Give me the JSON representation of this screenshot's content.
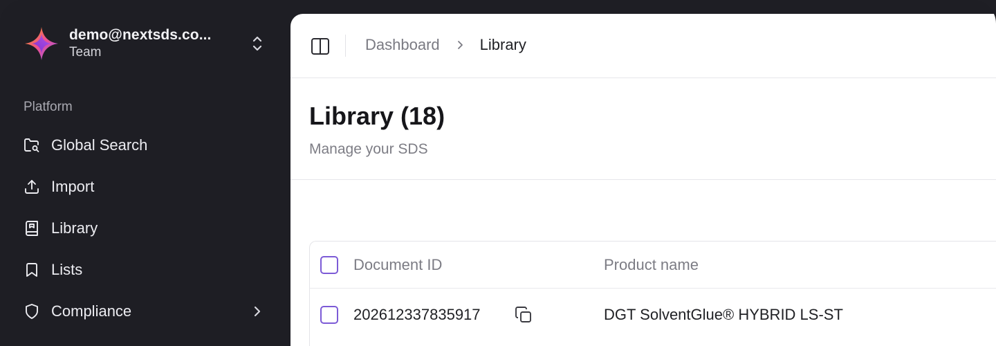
{
  "colors": {
    "sidebar_bg": "#1e1e24",
    "accent": "#7c5ad6",
    "logo_gradient": [
      "#f0528f",
      "#8b5cf6",
      "#f59e0b"
    ]
  },
  "team": {
    "email": "demo@nextsds.co...",
    "role": "Team",
    "logo_icon": "sparkle-logo-icon",
    "switcher_icon": "chevrons-up-down-icon"
  },
  "sidebar": {
    "section_label": "Platform",
    "items": [
      {
        "label": "Global Search",
        "icon": "folder-search-icon"
      },
      {
        "label": "Import",
        "icon": "upload-icon"
      },
      {
        "label": "Library",
        "icon": "book-icon"
      },
      {
        "label": "Lists",
        "icon": "bookmark-icon"
      },
      {
        "label": "Compliance",
        "icon": "shield-icon",
        "has_submenu": true
      }
    ]
  },
  "topbar": {
    "toggle_icon": "panel-left-icon",
    "breadcrumb": {
      "parent": "Dashboard",
      "current": "Library"
    }
  },
  "page": {
    "title": "Library (18)",
    "subtitle": "Manage your SDS"
  },
  "table": {
    "columns": [
      "Document ID",
      "Product name"
    ],
    "rows": [
      {
        "document_id": "202612337835917",
        "product_name": "DGT SolventGlue® HYBRID LS-ST"
      }
    ]
  }
}
